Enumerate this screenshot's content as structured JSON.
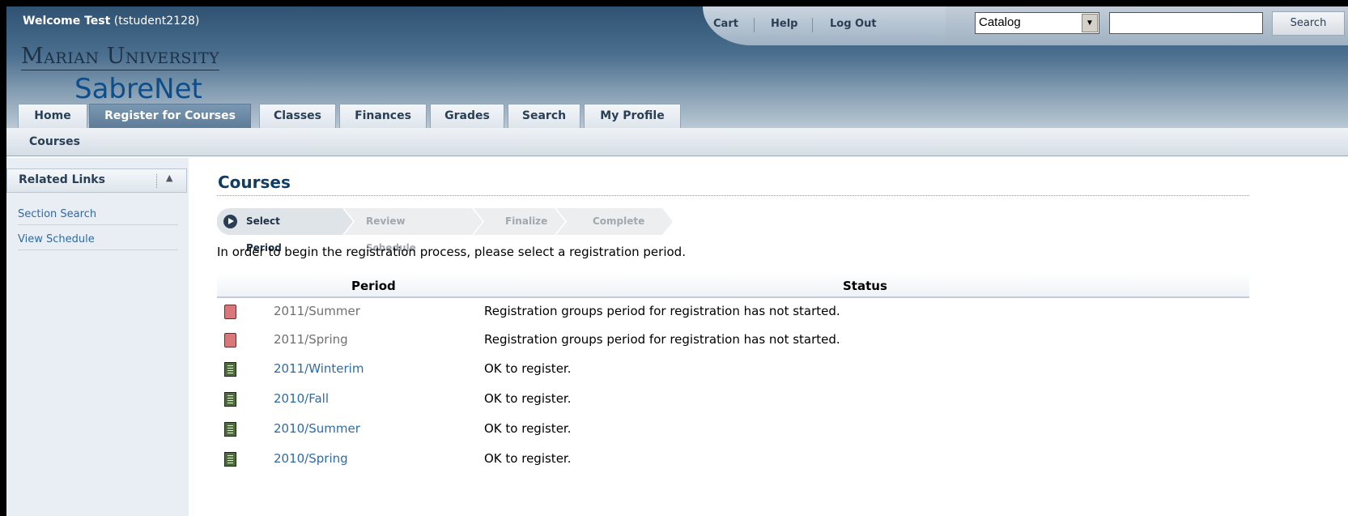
{
  "header": {
    "welcome_prefix": "Welcome Test",
    "welcome_user": "(tstudent2128)",
    "logo_line1": "Marian University",
    "logo_line2": "SabreNet",
    "util_links": [
      "Cart",
      "Help",
      "Log Out"
    ],
    "search": {
      "scope_value": "Catalog",
      "input_value": "",
      "button_label": "Search"
    }
  },
  "tabs": [
    {
      "label": "Home",
      "active": false
    },
    {
      "label": "Register for Courses",
      "active": true
    },
    {
      "label": "Classes",
      "active": false
    },
    {
      "label": "Finances",
      "active": false
    },
    {
      "label": "Grades",
      "active": false
    },
    {
      "label": "Search",
      "active": false
    },
    {
      "label": "My Profile",
      "active": false
    }
  ],
  "subnav": {
    "item": "Courses"
  },
  "related_links": {
    "title": "Related Links",
    "items": [
      "Section Search",
      "View Schedule"
    ]
  },
  "main": {
    "title": "Courses",
    "steps": [
      "Select Period",
      "Review Schedule",
      "Finalize",
      "Complete"
    ],
    "active_step": "Select Period",
    "instructions": "In order to begin the registration process, please select a registration period.",
    "table": {
      "headers": {
        "period": "Period",
        "status": "Status"
      },
      "rows": [
        {
          "period": "2011/Summer",
          "status": "Registration groups period for registration has not started.",
          "icon": "closed-book-icon",
          "available": false
        },
        {
          "period": "2011/Spring",
          "status": "Registration groups period for registration has not started.",
          "icon": "closed-book-icon",
          "available": false
        },
        {
          "period": "2011/Winterim",
          "status": "OK to register.",
          "icon": "open-book-icon",
          "available": true
        },
        {
          "period": "2010/Fall",
          "status": "OK to register.",
          "icon": "open-book-icon",
          "available": true
        },
        {
          "period": "2010/Summer",
          "status": "OK to register.",
          "icon": "open-book-icon",
          "available": true
        },
        {
          "period": "2010/Spring",
          "status": "OK to register.",
          "icon": "open-book-icon",
          "available": true
        }
      ]
    }
  },
  "colors": {
    "header_dark": "#2f5273",
    "title": "#0f3d66",
    "link": "#2f6ba3",
    "unavailable_icon": "#d9777b",
    "available_icon": "#4d6b3d"
  }
}
